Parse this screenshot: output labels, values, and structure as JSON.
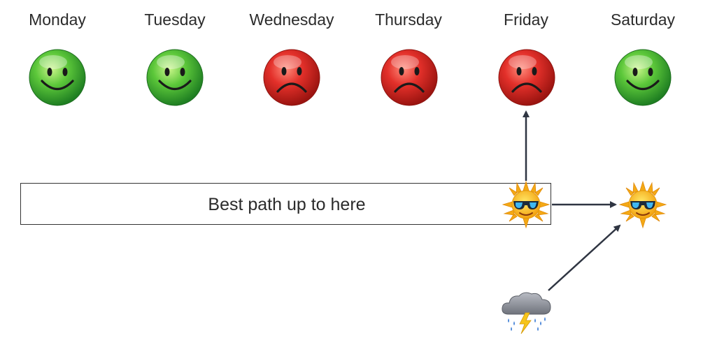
{
  "days": [
    {
      "label": "Monday",
      "mood": "happy"
    },
    {
      "label": "Tuesday",
      "mood": "happy"
    },
    {
      "label": "Wednesday",
      "mood": "sad"
    },
    {
      "label": "Thursday",
      "mood": "sad"
    },
    {
      "label": "Friday",
      "mood": "sad"
    },
    {
      "label": "Saturday",
      "mood": "happy"
    }
  ],
  "path_box": {
    "label": "Best path up to here"
  },
  "icons": {
    "happy": "smiley-face-icon",
    "sad": "frowning-face-icon",
    "sun": "sun-with-sunglasses-icon",
    "storm": "thunderstorm-cloud-icon"
  },
  "colors": {
    "happy": "#3fae32",
    "sad": "#d92a25",
    "arrow": "#2f3542",
    "sun": "#f7c21a",
    "box_border": "#333333"
  }
}
